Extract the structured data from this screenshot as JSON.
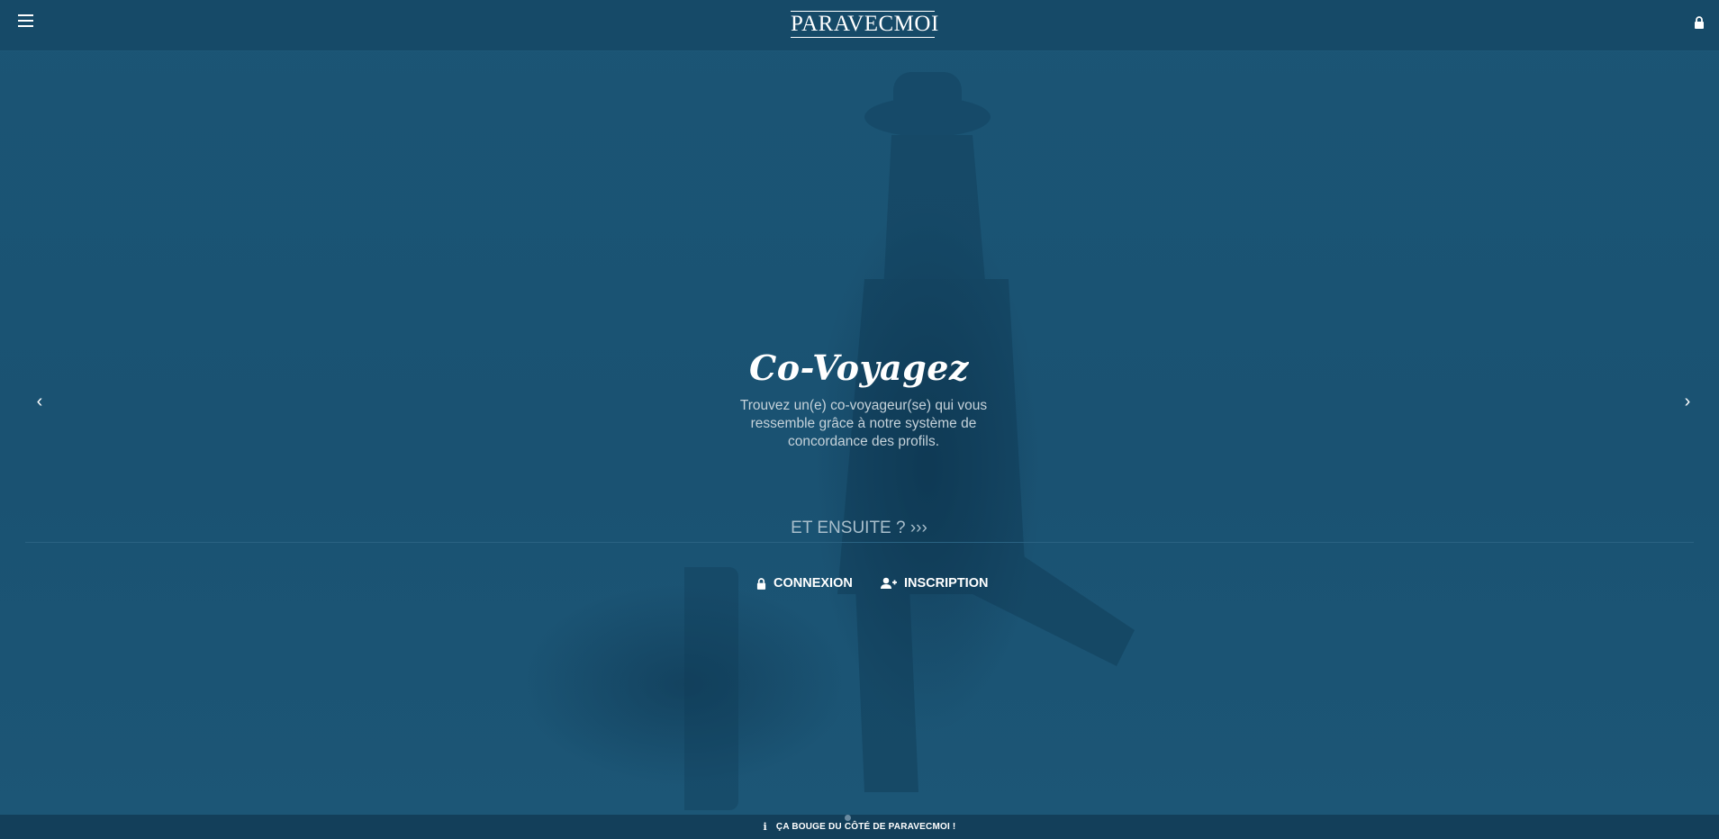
{
  "header": {
    "logo_text": "PARAVECMOI",
    "menu_icon": "hamburger-menu-icon",
    "lock_icon": "lock-icon"
  },
  "slider": {
    "title": "Co-Voyagez",
    "text": "Trouvez un(e) co-voyageur(se) qui vous ressemble grâce à notre système de concordance des profils.",
    "prev_icon": "chevron-left-icon",
    "next_icon": "chevron-right-icon"
  },
  "cta": {
    "next_label": "ET ENSUITE ? ›››"
  },
  "auth": {
    "login_label": "CONNEXION",
    "signup_label": "INSCRIPTION"
  },
  "footer": {
    "info_text": "ÇA BOUGE DU CÔTÉ DE PARAVECMOI !",
    "info_icon": "info-icon"
  },
  "colors": {
    "background": "#1a5272",
    "topbar": "#164a68",
    "footer": "#133f5a"
  }
}
